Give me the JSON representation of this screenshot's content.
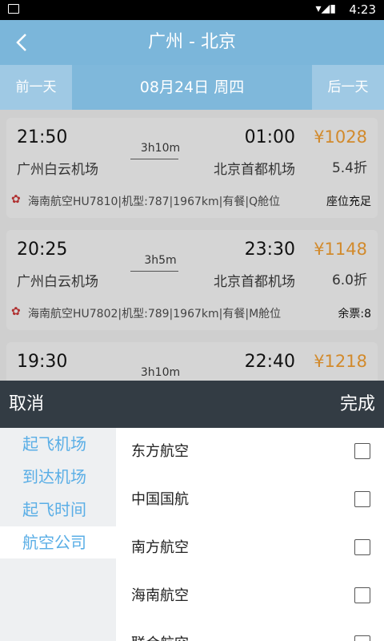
{
  "status_bar": {
    "time": "4:23"
  },
  "header": {
    "back_icon": "chevron-left-icon",
    "title": "广州 - 北京"
  },
  "date_nav": {
    "prev": "前一天",
    "date": "08月24日 周四",
    "next": "后一天"
  },
  "flights": [
    {
      "dep_time": "21:50",
      "arr_time": "01:00",
      "duration": "3h10m",
      "price": "¥1028",
      "dep_airport": "广州白云机场",
      "arr_airport": "北京首都机场",
      "discount": "5.4折",
      "info": "海南航空HU7810|机型:787|1967km|有餐|Q舱位",
      "seats": "座位充足"
    },
    {
      "dep_time": "20:25",
      "arr_time": "23:30",
      "duration": "3h5m",
      "price": "¥1148",
      "dep_airport": "广州白云机场",
      "arr_airport": "北京首都机场",
      "discount": "6.0折",
      "info": "海南航空HU7802|机型:789|1967km|有餐|M舱位",
      "seats": "余票:8"
    },
    {
      "dep_time": "19:30",
      "arr_time": "22:40",
      "duration": "3h10m",
      "price": "¥1218"
    }
  ],
  "filter": {
    "cancel": "取消",
    "done": "完成",
    "categories": [
      "起飞机场",
      "到达机场",
      "起飞时间",
      "航空公司"
    ],
    "active_category": "航空公司",
    "options": [
      {
        "label": "东方航空",
        "checked": false
      },
      {
        "label": "中国国航",
        "checked": false
      },
      {
        "label": "南方航空",
        "checked": false
      },
      {
        "label": "海南航空",
        "checked": false
      },
      {
        "label": "联合航空",
        "checked": false
      }
    ]
  },
  "colors": {
    "header_bg": "#7bb6da",
    "price": "#d28a2c",
    "category_text": "#5aaee6",
    "sheet_header_bg": "#333c44"
  }
}
